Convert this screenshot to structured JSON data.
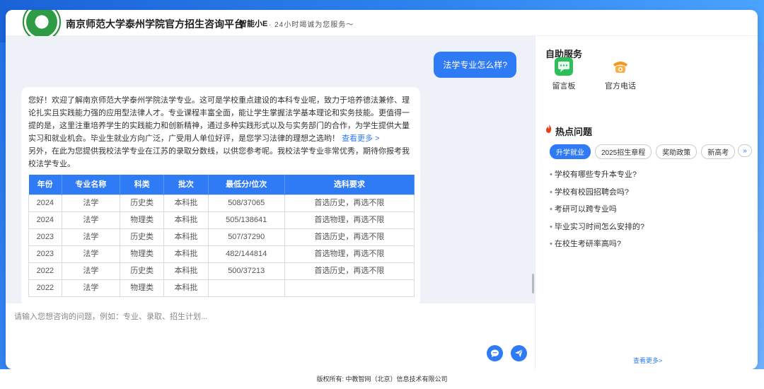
{
  "header": {
    "site_title": "南京师范大学泰州学院官方招生咨询平台",
    "bot_name": "智能小E",
    "bot_slogan": "· 24小时竭诚为您服务～"
  },
  "chat": {
    "user_message": "法学专业怎么样?",
    "bot_intro": "您好！欢迎了解南京师范大学泰州学院法学专业。这可是学校重点建设的本科专业呢，致力于培养德法兼修、理论扎实且实践能力强的应用型法律人才。专业课程丰富全面，能让学生掌握法学基本理论和实务技能。更值得一提的是，这里注重培养学生的实践能力和创新精神，通过多种实践形式以及与实务部门的合作，为学生提供大量实习和就业机会。毕业生就业方向广泛，广受用人单位好评，是您学习法律的理想之选哟！",
    "more_link": "查看更多 >",
    "bot_followup": "另外，在此为您提供我校法学专业在江苏的录取分数线，以供您参考呢。我校法学专业非常优秀，期待你报考我校法学专业。",
    "table": {
      "headers": [
        "年份",
        "专业名称",
        "科类",
        "批次",
        "最低分/位次",
        "选科要求"
      ],
      "rows": [
        [
          "2024",
          "法学",
          "历史类",
          "本科批",
          "508/37065",
          "首选历史，再选不限"
        ],
        [
          "2024",
          "法学",
          "物理类",
          "本科批",
          "505/138641",
          "首选物理，再选不限"
        ],
        [
          "2023",
          "法学",
          "历史类",
          "本科批",
          "507/37290",
          "首选历史，再选不限"
        ],
        [
          "2023",
          "法学",
          "物理类",
          "本科批",
          "482/144814",
          "首选物理，再选不限"
        ],
        [
          "2022",
          "法学",
          "历史类",
          "本科批",
          "500/37213",
          "首选历史，再选不限"
        ],
        [
          "2022",
          "法学",
          "物理类",
          "本科批",
          "",
          ""
        ]
      ]
    }
  },
  "input": {
    "placeholder": "请输入您想咨询的问题，例如：专业、录取、招生计划..."
  },
  "sidebar": {
    "services_title": "自助服务",
    "services": [
      {
        "label": "留言板",
        "icon": "message-board-icon",
        "color": "#2fbf5a"
      },
      {
        "label": "官方电话",
        "icon": "telephone-icon",
        "color": "#f39a1e"
      }
    ],
    "hot_title": "热点问题",
    "tabs": [
      "升学就业",
      "2025招生章程",
      "奖助政策",
      "新高考"
    ],
    "active_tab": 0,
    "hot_questions": [
      "学校有哪些专升本专业?",
      "学校有校园招聘会吗?",
      "考研可以跨专业吗",
      "毕业实习时间怎么安排的?",
      "在校生考研率高吗?"
    ],
    "see_more": "查看更多>"
  },
  "footer": {
    "copyright": "版权所有: 中教智网（北京）信息技术有限公司"
  },
  "colors": {
    "accent": "#2f7bf5",
    "chat_bg": "#eef1f8"
  }
}
